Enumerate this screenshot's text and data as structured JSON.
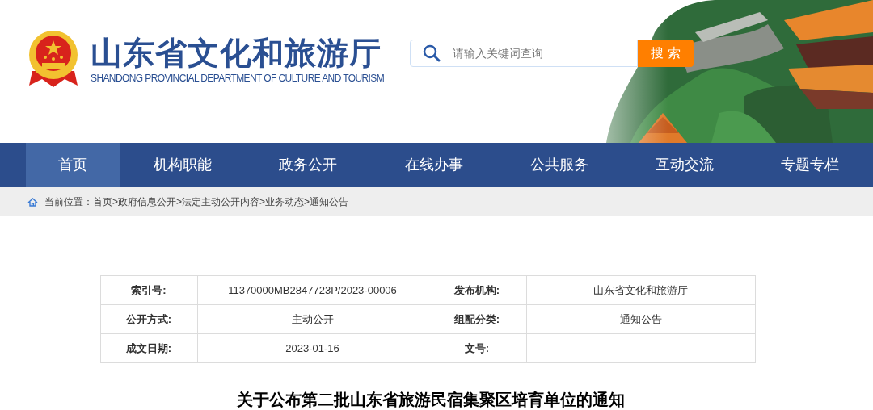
{
  "header": {
    "title": "山东省文化和旅游厅",
    "subtitle": "SHANDONG PROVINCIAL DEPARTMENT OF CULTURE AND TOURISM",
    "search": {
      "placeholder": "请输入关键词查询",
      "button": "搜 索"
    }
  },
  "nav": {
    "items": [
      {
        "label": "首页",
        "selected": true
      },
      {
        "label": "机构职能",
        "selected": false
      },
      {
        "label": "政务公开",
        "selected": false
      },
      {
        "label": "在线办事",
        "selected": false
      },
      {
        "label": "公共服务",
        "selected": false
      },
      {
        "label": "互动交流",
        "selected": false
      },
      {
        "label": "专题专栏",
        "selected": false
      }
    ]
  },
  "breadcrumb": {
    "label": "当前位置：",
    "separator": ">",
    "items": [
      "首页",
      "政府信息公开",
      "法定主动公开内容",
      "业务动态",
      "通知公告"
    ]
  },
  "info_table": {
    "rows": [
      [
        {
          "label": "索引号:",
          "value": "11370000MB2847723P/2023-00006"
        },
        {
          "label": "发布机构:",
          "value": "山东省文化和旅游厅"
        }
      ],
      [
        {
          "label": "公开方式:",
          "value": "主动公开"
        },
        {
          "label": "组配分类:",
          "value": "通知公告"
        }
      ],
      [
        {
          "label": "成文日期:",
          "value": "2023-01-16"
        },
        {
          "label": "文号:"
        }
      ]
    ]
  },
  "article": {
    "title": "关于公布第二批山东省旅游民宿集聚区培育单位的通知"
  }
}
